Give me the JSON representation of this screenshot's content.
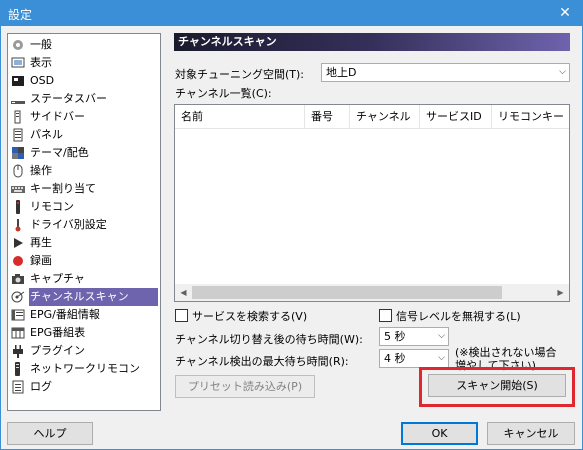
{
  "window": {
    "title": "設定",
    "close_glyph": "✕"
  },
  "sidebar": {
    "items": [
      {
        "label": "一般",
        "icon": "gear-icon"
      },
      {
        "label": "表示",
        "icon": "display-icon"
      },
      {
        "label": "OSD",
        "icon": "osd-icon"
      },
      {
        "label": "ステータスバー",
        "icon": "statusbar-icon"
      },
      {
        "label": "サイドバー",
        "icon": "sidebar-icon"
      },
      {
        "label": "パネル",
        "icon": "panel-icon"
      },
      {
        "label": "テーマ/配色",
        "icon": "palette-icon"
      },
      {
        "label": "操作",
        "icon": "mouse-icon"
      },
      {
        "label": "キー割り当て",
        "icon": "keyboard-icon"
      },
      {
        "label": "リモコン",
        "icon": "remote-icon"
      },
      {
        "label": "ドライバ別設定",
        "icon": "driver-icon"
      },
      {
        "label": "再生",
        "icon": "play-icon"
      },
      {
        "label": "録画",
        "icon": "record-icon"
      },
      {
        "label": "キャプチャ",
        "icon": "camera-icon"
      },
      {
        "label": "チャンネルスキャン",
        "icon": "antenna-icon"
      },
      {
        "label": "EPG/番組情報",
        "icon": "epg-icon"
      },
      {
        "label": "EPG番組表",
        "icon": "epg-table-icon"
      },
      {
        "label": "プラグイン",
        "icon": "plug-icon"
      },
      {
        "label": "ネットワークリモコン",
        "icon": "network-remote-icon"
      },
      {
        "label": "ログ",
        "icon": "log-icon"
      }
    ],
    "selected_index": 14
  },
  "panel": {
    "title": "チャンネルスキャン",
    "tuning_space_label": "対象チューニング空間(T):",
    "tuning_space_value": "地上D",
    "channel_list_label": "チャンネル一覧(C):",
    "columns": [
      "名前",
      "番号",
      "チャンネル",
      "サービスID",
      "リモコンキー"
    ],
    "search_services_label": "サービスを検索する(V)",
    "ignore_signal_label": "信号レベルを無視する(L)",
    "switch_wait_label": "チャンネル切り替え後の待ち時間(W):",
    "switch_wait_value": "5 秒",
    "detect_wait_label": "チャンネル検出の最大待ち時間(R):",
    "detect_wait_value": "4 秒",
    "note_line1": "(※検出されない場合",
    "note_line2": "増やして下さい)",
    "preset_button": "プリセット読み込み(P)",
    "scan_button": "スキャン開始(S)"
  },
  "footer": {
    "help_button": "ヘルプ",
    "ok_button": "OK",
    "cancel_button": "キャンセル"
  },
  "colors": {
    "selection": "#6e63ad",
    "title_bar": "#3a8fd6",
    "highlight": "#e0262e",
    "default_button_border": "#0078d7"
  }
}
